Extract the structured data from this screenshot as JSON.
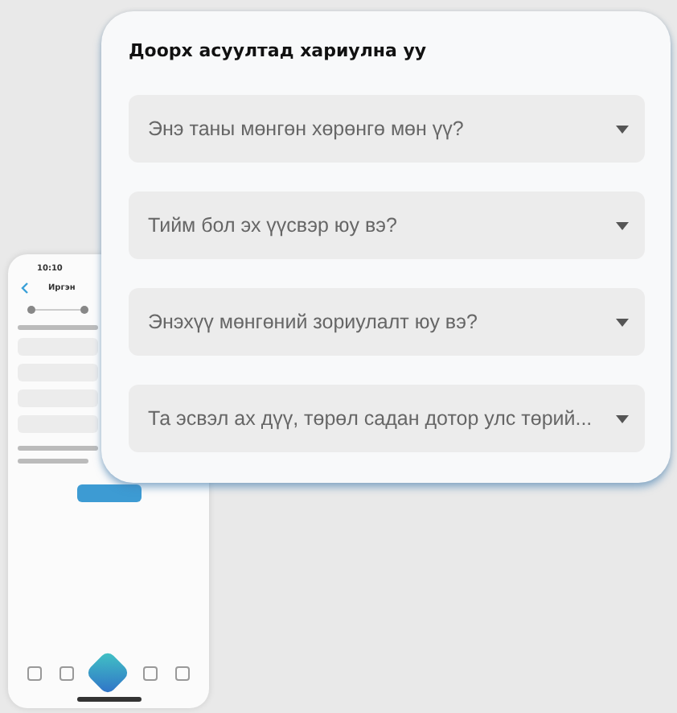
{
  "phone": {
    "time": "10:10",
    "title": "Иргэн"
  },
  "card": {
    "heading": "Доорх асуултад хариулна уу",
    "questions": [
      {
        "text": "Энэ таны мөнгөн хөрөнгө мөн үү?"
      },
      {
        "text": "Тийм бол эх үүсвэр юу вэ?"
      },
      {
        "text": "Энэхүү мөнгөний зориулалт юу вэ?"
      },
      {
        "text": "Та эсвэл ах дүү, төрөл садан дотор улс төрий..."
      }
    ]
  }
}
